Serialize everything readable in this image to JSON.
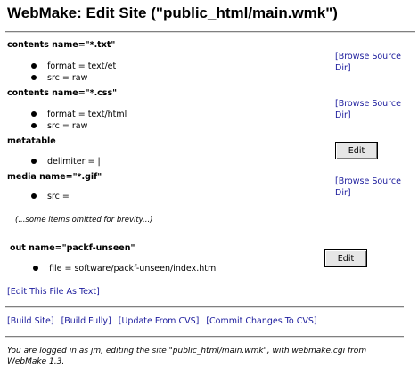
{
  "page_title": "WebMake: Edit Site (\"public_html/main.wmk\")",
  "sections": [
    {
      "heading": "contents name=\"*.txt\"",
      "items": [
        "format = text/et",
        "src = raw"
      ],
      "action": "[Browse Source Dir]",
      "action_lines": [
        "[Browse Source",
        "Dir]"
      ]
    },
    {
      "heading": "contents name=\"*.css\"",
      "items": [
        "format = text/html",
        "src = raw"
      ],
      "action": "[Browse Source Dir]",
      "action_lines": [
        "[Browse Source",
        "Dir]"
      ]
    },
    {
      "heading": "metatable",
      "items": [
        "delimiter = |"
      ],
      "button": "Edit"
    },
    {
      "heading": "media name=\"*.gif\"",
      "items": [
        "src ="
      ],
      "action": "[Browse Source Dir]",
      "action_lines": [
        "[Browse Source",
        "Dir]"
      ]
    }
  ],
  "omitted_note": "(...some items omitted for brevity...)",
  "out_section": {
    "heading": "out name=\"packf-unseen\"",
    "items": [
      "file = software/packf-unseen/index.html"
    ],
    "button": "Edit"
  },
  "edit_file_link": "[Edit This File As Text]",
  "bottom_links": [
    "[Build Site]",
    "[Build Fully]",
    "[Update From CVS]",
    "[Commit Changes To CVS]"
  ],
  "footer": "You are logged in as jm, editing the site \"public_html/main.wmk\", with webmake.cgi from WebMake 1.3."
}
